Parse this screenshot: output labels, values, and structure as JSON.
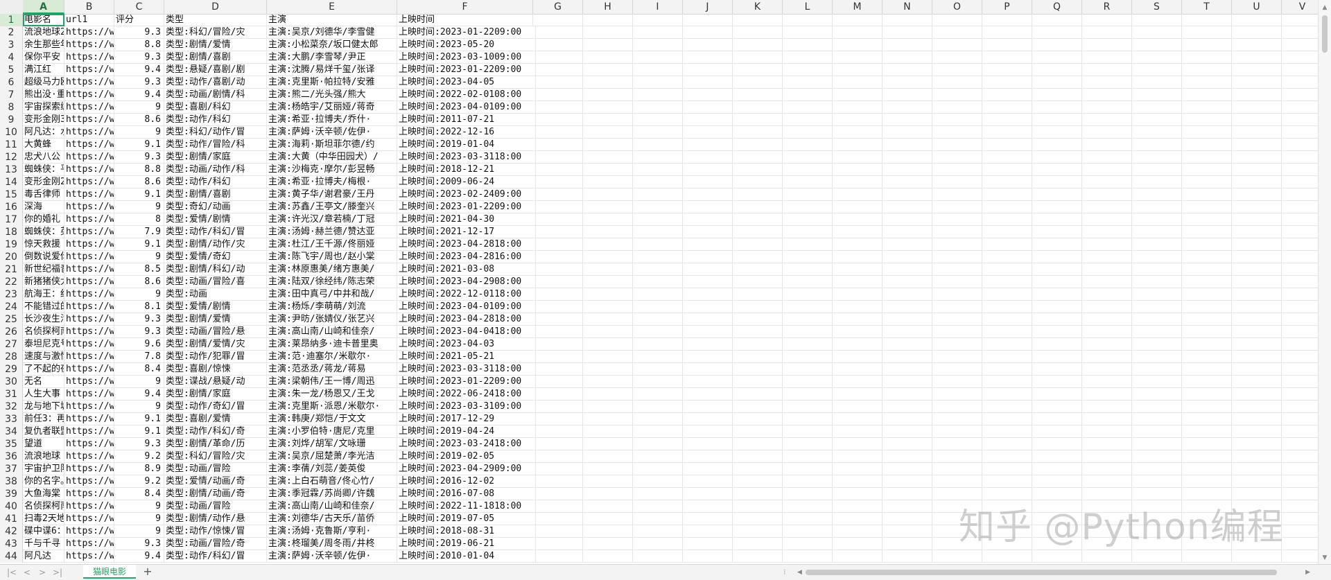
{
  "columns": [
    "A",
    "B",
    "C",
    "D",
    "E",
    "F",
    "G",
    "H",
    "I",
    "J",
    "K",
    "L",
    "M",
    "N",
    "O",
    "P",
    "Q",
    "R",
    "S",
    "T",
    "U",
    "V"
  ],
  "header_row": [
    "电影名",
    "url1",
    "评分",
    "类型",
    "主演",
    "上映时间"
  ],
  "rows": [
    [
      "流浪地球2",
      "https://w",
      "9.3",
      "类型:科幻/冒险/灾",
      "主演:吴京/刘德华/李雪健",
      "上映时间:2023-01-2209:00"
    ],
    [
      "余生那些年",
      "https://w",
      "8.8",
      "类型:剧情/爱情",
      "主演:小松菜奈/坂口健太郎",
      "上映时间:2023-05-20"
    ],
    [
      "保你平安",
      "https://w",
      "9.3",
      "类型:剧情/喜剧",
      "主演:大鹏/李雪琴/尹正",
      "上映时间:2023-03-1009:00"
    ],
    [
      "满江红",
      "https://w",
      "9.4",
      "类型:悬疑/喜剧/剧",
      "主演:沈腾/易烊千玺/张译",
      "上映时间:2023-01-2209:00"
    ],
    [
      "超级马力欧",
      "https://w",
      "9.3",
      "类型:动作/喜剧/动",
      "主演:克里斯·帕拉特/安雅",
      "上映时间:2023-04-05"
    ],
    [
      "熊出没·重",
      "https://w",
      "9.4",
      "类型:动画/剧情/科",
      "主演:熊二/光头强/熊大",
      "上映时间:2022-02-0108:00"
    ],
    [
      "宇宙探索编",
      "https://w",
      "9",
      "类型:喜剧/科幻",
      "主演:杨皓宇/艾丽娅/蒋奇",
      "上映时间:2023-04-0109:00"
    ],
    [
      "变形金刚3",
      "https://w",
      "8.6",
      "类型:动作/科幻",
      "主演:希亚·拉博夫/乔什·",
      "上映时间:2011-07-21"
    ],
    [
      "阿凡达：水",
      "https://w",
      "9",
      "类型:科幻/动作/冒",
      "主演:萨姆·沃辛顿/佐伊·",
      "上映时间:2022-12-16"
    ],
    [
      "大黄蜂",
      "https://w",
      "9.1",
      "类型:动作/冒险/科",
      "主演:海莉·斯坦菲尔德/约",
      "上映时间:2019-01-04"
    ],
    [
      "忠犬八公",
      "https://w",
      "9.3",
      "类型:剧情/家庭",
      "主演:大黄（中华田园犬）/",
      "上映时间:2023-03-3118:00"
    ],
    [
      "蜘蛛侠：平",
      "https://w",
      "8.8",
      "类型:动画/动作/科",
      "主演:沙梅克·摩尔/彭昱畅",
      "上映时间:2018-12-21"
    ],
    [
      "变形金刚2",
      "https://w",
      "8.6",
      "类型:动作/科幻",
      "主演:希亚·拉博夫/梅根·",
      "上映时间:2009-06-24"
    ],
    [
      "毒舌律师",
      "https://w",
      "9.1",
      "类型:剧情/喜剧",
      "主演:黄子华/谢君豪/王丹",
      "上映时间:2023-02-2409:00"
    ],
    [
      "深海",
      "https://w",
      "9",
      "类型:奇幻/动画",
      "主演:苏鑫/王亭文/滕奎兴",
      "上映时间:2023-01-2209:00"
    ],
    [
      "你的婚礼",
      "https://w",
      "8",
      "类型:爱情/剧情",
      "主演:许光汉/章若楠/丁冠",
      "上映时间:2021-04-30"
    ],
    [
      "蜘蛛侠：英",
      "https://w",
      "7.9",
      "类型:动作/科幻/冒",
      "主演:汤姆·赫兰德/赞达亚",
      "上映时间:2021-12-17"
    ],
    [
      "惊天救援",
      "https://w",
      "9.1",
      "类型:剧情/动作/灾",
      "主演:杜江/王千源/佟丽娅",
      "上映时间:2023-04-2818:00"
    ],
    [
      "倒数说爱你",
      "https://w",
      "9",
      "类型:爱情/奇幻",
      "主演:陈飞宇/周也/赵小棠",
      "上映时间:2023-04-2816:00"
    ],
    [
      "新世纪福音",
      "https://w",
      "8.5",
      "类型:剧情/科幻/动",
      "主演:林原惠美/绪方惠美/",
      "上映时间:2021-03-08"
    ],
    [
      "新猪猪侠大",
      "https://w",
      "8.6",
      "类型:动画/冒险/喜",
      "主演:陆双/徐经纬/陈志荣",
      "上映时间:2023-04-2908:00"
    ],
    [
      "航海王：红",
      "https://w",
      "9",
      "类型:动画",
      "主演:田中真弓/中井和哉/",
      "上映时间:2022-12-0118:00"
    ],
    [
      "不能错过的",
      "https://w",
      "8.1",
      "类型:爱情/剧情",
      "主演:杨烁/李萌萌/刘流",
      "上映时间:2023-04-0109:00"
    ],
    [
      "长沙夜生活",
      "https://w",
      "9.3",
      "类型:剧情/爱情",
      "主演:尹昉/张婧仪/张艺兴",
      "上映时间:2023-04-2818:00"
    ],
    [
      "名侦探柯南",
      "https://w",
      "9.3",
      "类型:动画/冒险/悬",
      "主演:高山南/山崎和佳奈/",
      "上映时间:2023-04-0418:00"
    ],
    [
      "泰坦尼克号",
      "https://w",
      "9.6",
      "类型:剧情/爱情/灾",
      "主演:莱昂纳多·迪卡普里奥",
      "上映时间:2023-04-03"
    ],
    [
      "速度与激情",
      "https://w",
      "7.8",
      "类型:动作/犯罪/冒",
      "主演:范·迪塞尔/米歇尔·",
      "上映时间:2021-05-21"
    ],
    [
      "了不起的夜",
      "https://w",
      "8.4",
      "类型:喜剧/惊悚",
      "主演:范丞丞/蒋龙/蒋易",
      "上映时间:2023-03-3118:00"
    ],
    [
      "无名",
      "https://w",
      "9",
      "类型:谍战/悬疑/动",
      "主演:梁朝伟/王一博/周迅",
      "上映时间:2023-01-2209:00"
    ],
    [
      "人生大事",
      "https://w",
      "9.4",
      "类型:剧情/家庭",
      "主演:朱一龙/杨恩又/王戈",
      "上映时间:2022-06-2418:00"
    ],
    [
      "龙与地下城",
      "https://w",
      "9",
      "类型:动作/奇幻/冒",
      "主演:克里斯·派恩/米歇尔·",
      "上映时间:2023-03-3109:00"
    ],
    [
      "前任3：再",
      "https://w",
      "9.1",
      "类型:喜剧/爱情",
      "主演:韩庚/郑恺/于文文",
      "上映时间:2017-12-29"
    ],
    [
      "复仇者联盟",
      "https://w",
      "9.1",
      "类型:动作/科幻/奇",
      "主演:小罗伯特·唐尼/克里",
      "上映时间:2019-04-24"
    ],
    [
      "望道",
      "https://w",
      "9.3",
      "类型:剧情/革命/历",
      "主演:刘烨/胡军/文咏珊",
      "上映时间:2023-03-2418:00"
    ],
    [
      "流浪地球",
      "https://w",
      "9.2",
      "类型:科幻/冒险/灾",
      "主演:吴京/屈楚萧/李光洁",
      "上映时间:2019-02-05"
    ],
    [
      "宇宙护卫队",
      "https://w",
      "8.9",
      "类型:动画/冒险",
      "主演:李蒨/刘蕊/姜英俊",
      "上映时间:2023-04-2909:00"
    ],
    [
      "你的名字。",
      "https://w",
      "9.2",
      "类型:爱情/动画/奇",
      "主演:上白石萌音/佟心竹/",
      "上映时间:2016-12-02"
    ],
    [
      "大鱼海棠",
      "https://w",
      "8.4",
      "类型:剧情/动画/奇",
      "主演:季冠霖/苏尚卿/许魏",
      "上映时间:2016-07-08"
    ],
    [
      "名侦探柯南",
      "https://w",
      "9",
      "类型:动画/冒险",
      "主演:高山南/山崎和佳奈/",
      "上映时间:2022-11-1818:00"
    ],
    [
      "扫毒2天地",
      "https://w",
      "9",
      "类型:剧情/动作/悬",
      "主演:刘德华/古天乐/苗侨",
      "上映时间:2019-07-05"
    ],
    [
      "碟中谍6：",
      "https://w",
      "9",
      "类型:动作/惊悚/冒",
      "主演:汤姆·克鲁斯/亨利·",
      "上映时间:2018-08-31"
    ],
    [
      "千与千寻",
      "https://w",
      "9.3",
      "类型:动画/冒险/奇",
      "主演:柊瑠美/周冬雨/井柊",
      "上映时间:2019-06-21"
    ],
    [
      "阿凡达",
      "https://w",
      "9.4",
      "类型:动作/科幻/冒",
      "主演:萨姆·沃辛顿/佐伊·",
      "上映时间:2010-01-04"
    ]
  ],
  "sheet_tab": "猫眼电影",
  "add_sheet": "+",
  "nav": [
    "|<",
    "<",
    ">",
    ">|"
  ],
  "watermark": "知乎 @Python编程",
  "accent_color": "#21a366"
}
